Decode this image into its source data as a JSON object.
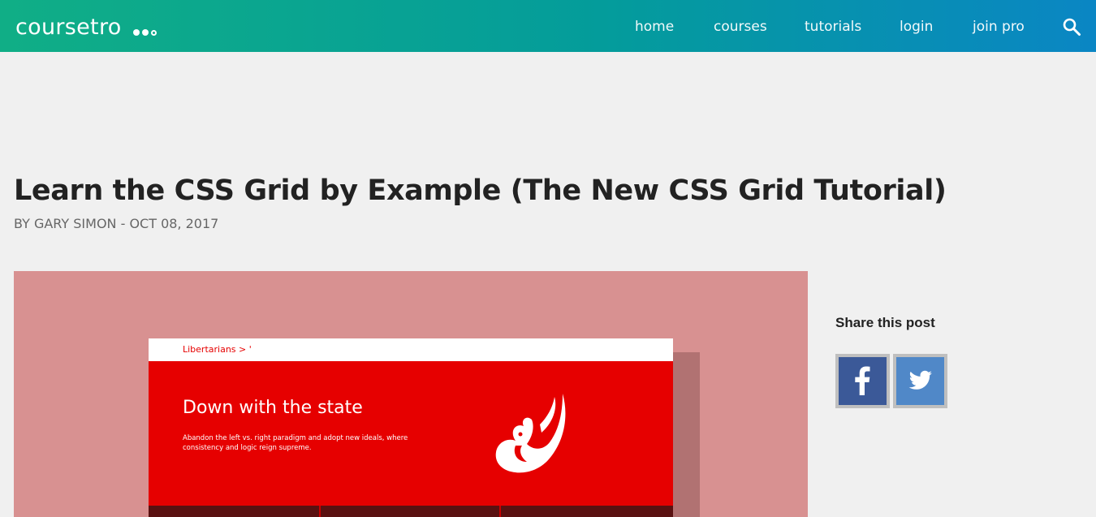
{
  "header": {
    "logo_text": "coursetro",
    "nav": [
      {
        "label": "home"
      },
      {
        "label": "courses"
      },
      {
        "label": "tutorials"
      },
      {
        "label": "login"
      },
      {
        "label": "join pro"
      }
    ],
    "search_icon": "search-icon"
  },
  "post": {
    "title": "Learn the CSS Grid by Example (The New CSS Grid Tutorial)",
    "meta": "BY GARY SIMON - OCT 08, 2017"
  },
  "hero": {
    "brand": "Libertarians > '",
    "heading": "Down with the state",
    "subtext": "Abandon the left vs. right paradigm and adopt new ideals, where consistency and logic reign supreme.",
    "emblem_icon": "eagle-emblem-icon"
  },
  "share": {
    "title": "Share this post",
    "buttons": [
      {
        "icon": "facebook-icon"
      },
      {
        "icon": "twitter-icon"
      }
    ]
  },
  "colors": {
    "header_start": "#10ae86",
    "header_end": "#0a86c4",
    "hero_bg": "#d89191",
    "mock_red": "#e60000",
    "facebook": "#3b5998",
    "twitter": "#5088c8"
  }
}
